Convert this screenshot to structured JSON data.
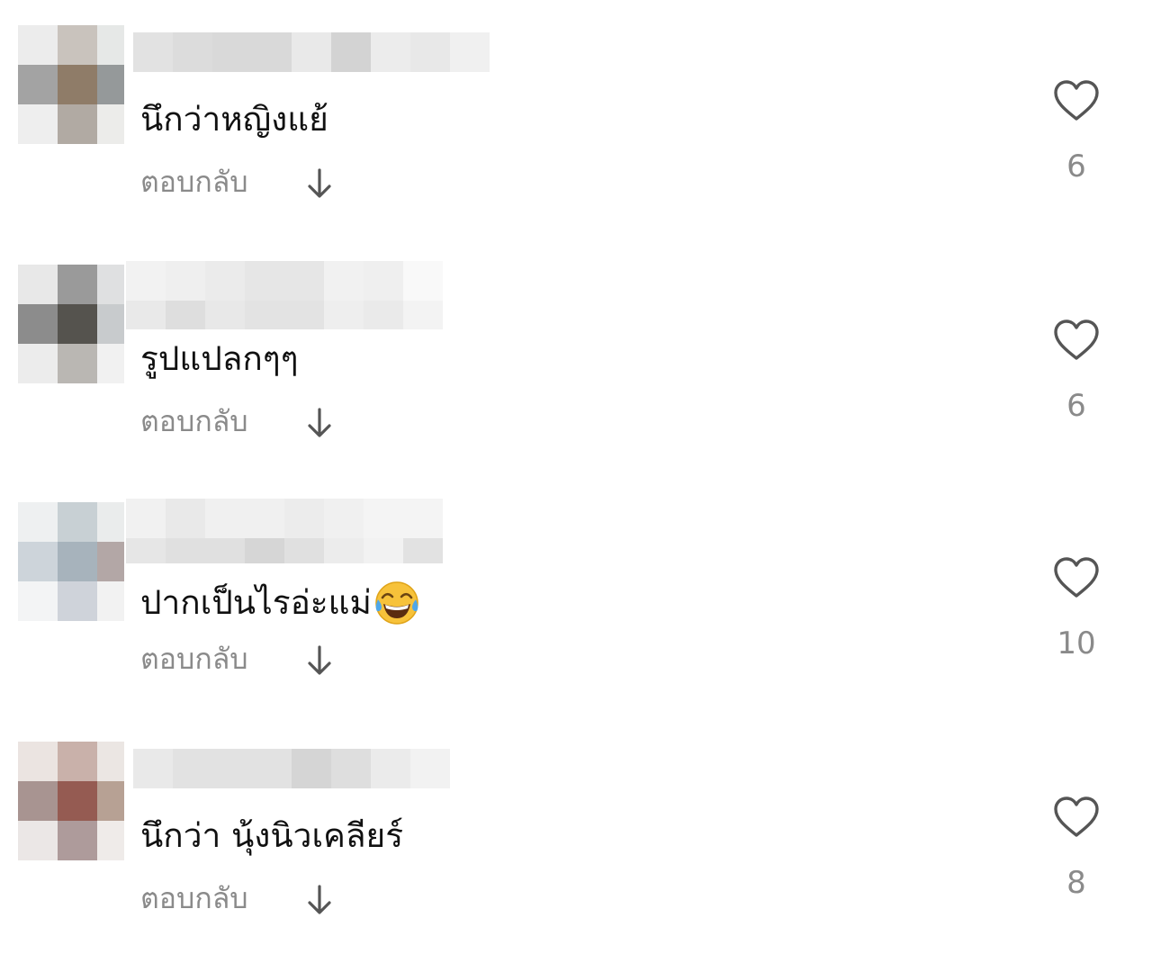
{
  "comments": [
    {
      "text": "นึกว่าหญิงแย้",
      "reply_label": "ตอบกลับ",
      "likes": "6"
    },
    {
      "text": "รูปแปลกๆๆ",
      "reply_label": "ตอบกลับ",
      "likes": "6"
    },
    {
      "text": "ปากเป็นไรอ่ะแม่",
      "emoji": "face-with-tears-of-joy",
      "reply_label": "ตอบกลับ",
      "likes": "10"
    },
    {
      "text": "นึกว่า นุ้งนิวเคลียร์",
      "reply_label": "ตอบกลับ",
      "likes": "8"
    }
  ],
  "colors": {
    "text": "#111111",
    "secondary": "#8a8a8a",
    "icon": "#555555"
  }
}
